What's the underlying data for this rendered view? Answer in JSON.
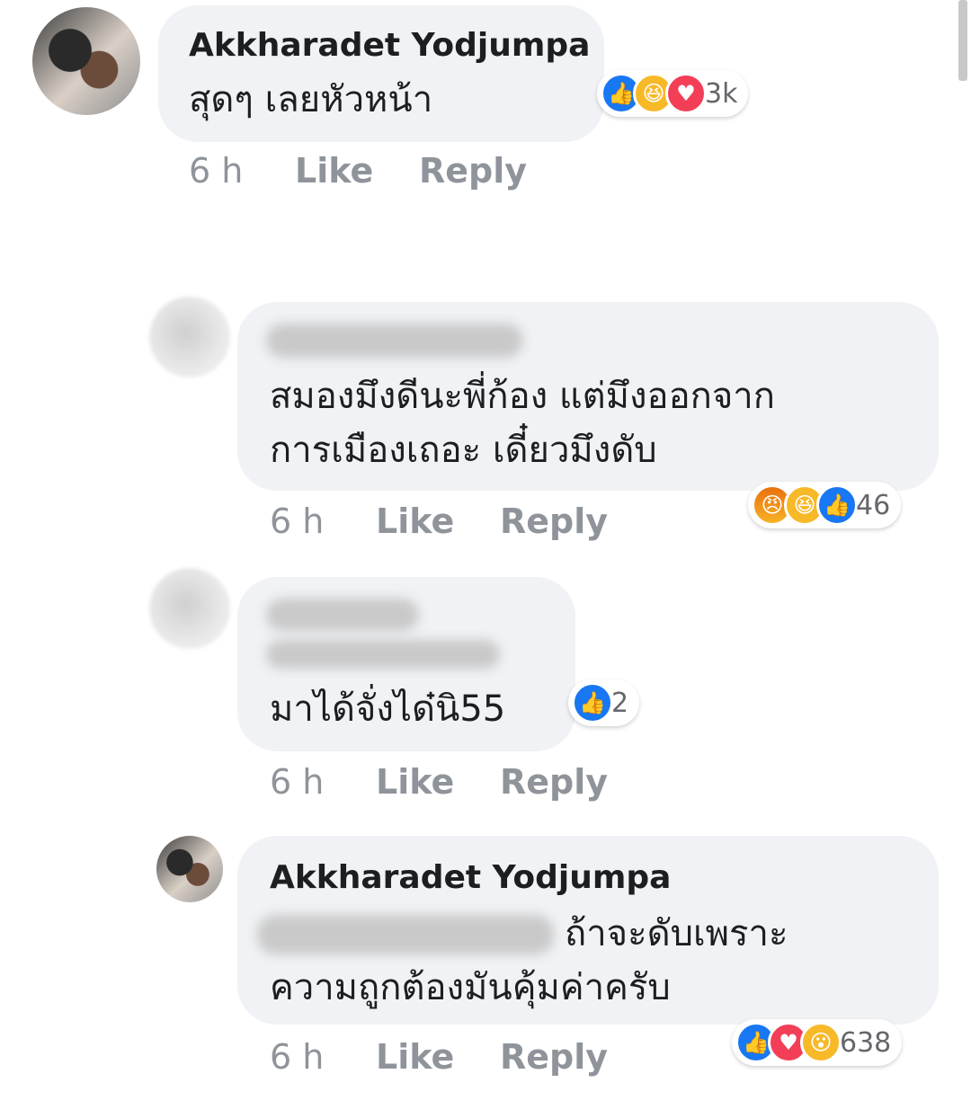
{
  "comments": [
    {
      "name": "Akkharadet Yodjumpa",
      "lines": [
        "สุดๆ เลยหัวหน้า"
      ],
      "time": "6 h",
      "like": "Like",
      "reply": "Reply",
      "reactions": [
        "like-icon",
        "haha-icon",
        "love-icon"
      ],
      "count": "3k"
    },
    {
      "name": "",
      "lines": [
        "สมองมึงดีนะพี่ก้อง แต่มึงออกจาก",
        "การเมืองเถอะ เดี๋ยวมึงดับ"
      ],
      "time": "6 h",
      "like": "Like",
      "reply": "Reply",
      "reactions": [
        "angry-icon",
        "haha-icon",
        "like-icon"
      ],
      "count": "46"
    },
    {
      "name": "",
      "lines": [
        "มาได้จั่งได๋นิ55"
      ],
      "time": "6 h",
      "like": "Like",
      "reply": "Reply",
      "reactions": [
        "like-icon"
      ],
      "count": "2"
    },
    {
      "name": "Akkharadet Yodjumpa",
      "lines": [
        "ถ้าจะดับเพราะ",
        "ความถูกต้องมันคุ้มค่าครับ"
      ],
      "time": "6 h",
      "like": "Like",
      "reply": "Reply",
      "reactions": [
        "like-icon",
        "love-icon",
        "wow-icon"
      ],
      "count": "638"
    }
  ],
  "colors": {
    "bubble": "#f0f2f5",
    "meta": "#8f949b",
    "like": "#1877f2",
    "love": "#f33e58",
    "haha": "#f7b928"
  }
}
